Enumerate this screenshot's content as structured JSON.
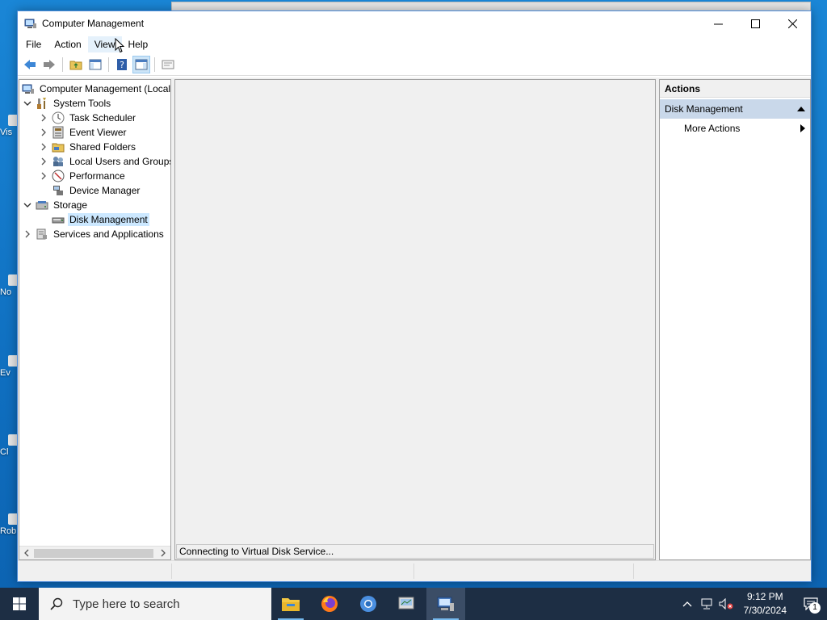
{
  "window": {
    "title": "Computer Management"
  },
  "menu": [
    "File",
    "Action",
    "View",
    "Help"
  ],
  "tree": [
    {
      "label": "Computer Management (Local",
      "level": 0,
      "expander": "none",
      "icon": "computer-management-icon"
    },
    {
      "label": "System Tools",
      "level": 1,
      "expander": "expanded",
      "icon": "system-tools-icon"
    },
    {
      "label": "Task Scheduler",
      "level": 2,
      "expander": "collapsed",
      "icon": "clock-icon"
    },
    {
      "label": "Event Viewer",
      "level": 2,
      "expander": "collapsed",
      "icon": "event-viewer-icon"
    },
    {
      "label": "Shared Folders",
      "level": 2,
      "expander": "collapsed",
      "icon": "shared-folder-icon"
    },
    {
      "label": "Local Users and Groups",
      "level": 2,
      "expander": "collapsed",
      "icon": "users-icon"
    },
    {
      "label": "Performance",
      "level": 2,
      "expander": "collapsed",
      "icon": "performance-icon"
    },
    {
      "label": "Device Manager",
      "level": 2,
      "expander": "none",
      "icon": "device-manager-icon"
    },
    {
      "label": "Storage",
      "level": 1,
      "expander": "expanded",
      "icon": "storage-icon"
    },
    {
      "label": "Disk Management",
      "level": 2,
      "expander": "none",
      "icon": "disk-icon",
      "selected": true
    },
    {
      "label": "Services and Applications",
      "level": 1,
      "expander": "collapsed",
      "icon": "services-icon"
    }
  ],
  "center": {
    "status": "Connecting to Virtual Disk Service..."
  },
  "actions": {
    "header": "Actions",
    "section": "Disk Management",
    "item": "More Actions"
  },
  "taskbar": {
    "search_placeholder": "Type here to search",
    "time": "9:12 PM",
    "date": "7/30/2024",
    "notification_count": "1"
  }
}
